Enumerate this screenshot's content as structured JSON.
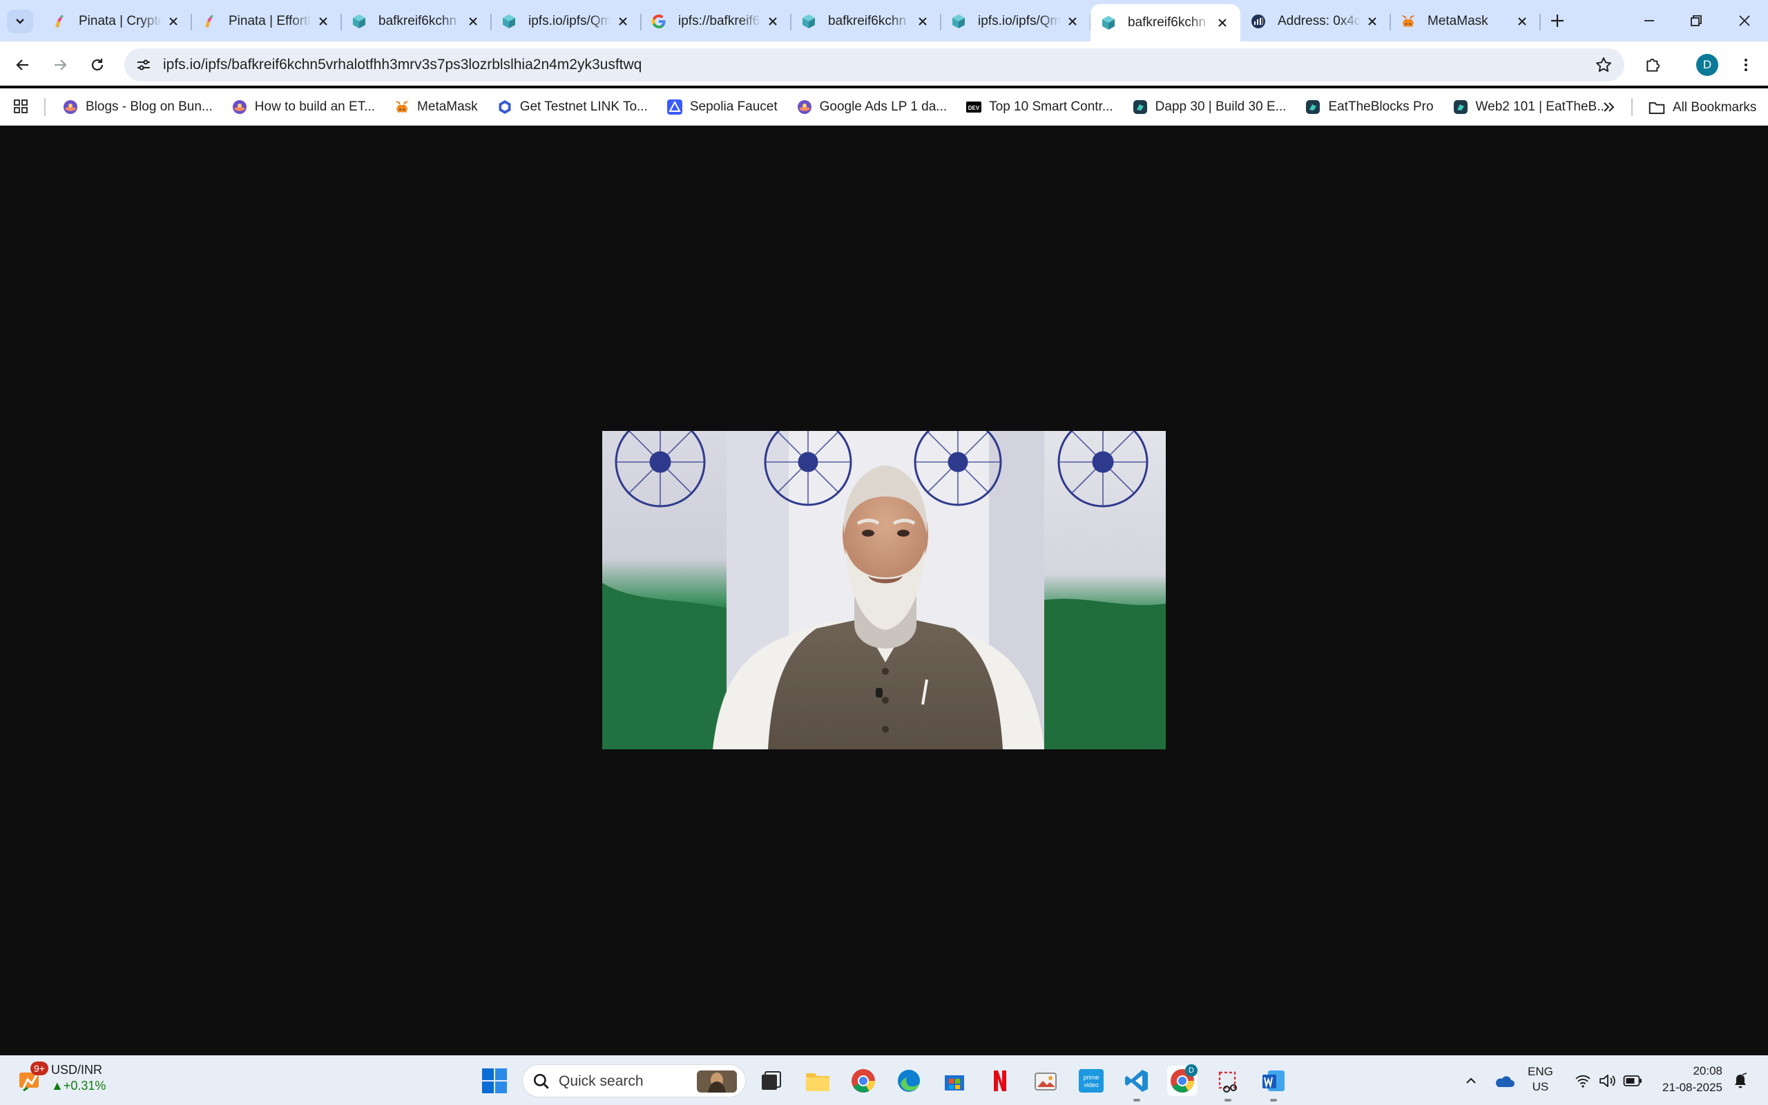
{
  "browser": {
    "tabs": [
      {
        "title": "Pinata | Crypto",
        "icon": "pinata-icon",
        "active": false
      },
      {
        "title": "Pinata | Effortless",
        "icon": "pinata-icon",
        "active": false
      },
      {
        "title": "bafkreif6kchn",
        "icon": "ipfs-cube-icon",
        "active": false
      },
      {
        "title": "ipfs.io/ipfs/Qm",
        "icon": "ipfs-cube-icon",
        "active": false
      },
      {
        "title": "ipfs://bafkreif6",
        "icon": "google-icon",
        "active": false
      },
      {
        "title": "bafkreif6kchn",
        "icon": "ipfs-cube-icon",
        "active": false
      },
      {
        "title": "ipfs.io/ipfs/Qm",
        "icon": "ipfs-cube-icon",
        "active": false
      },
      {
        "title": "bafkreif6kchn",
        "icon": "ipfs-cube-icon",
        "active": true
      },
      {
        "title": "Address: 0x4d",
        "icon": "etherscan-icon",
        "active": false
      },
      {
        "title": "MetaMask",
        "icon": "metamask-fox-icon",
        "active": false
      }
    ],
    "url": "ipfs.io/ipfs/bafkreif6kchn5vrhalotfhh3mrv3s7ps3lozrblslhia2n4m2yk3usftwq",
    "profile_initial": "D",
    "bookmarks": [
      {
        "label": "Blogs - Blog on Bun...",
        "icon": "bunny-icon"
      },
      {
        "label": "How to build an ET...",
        "icon": "bunny-icon"
      },
      {
        "label": "MetaMask",
        "icon": "metamask-fox-icon"
      },
      {
        "label": "Get Testnet LINK To...",
        "icon": "chainlink-icon"
      },
      {
        "label": "Sepolia Faucet",
        "icon": "alchemy-icon"
      },
      {
        "label": "Google Ads LP 1 da...",
        "icon": "bunny-icon"
      },
      {
        "label": "Top 10 Smart Contr...",
        "icon": "dev-icon"
      },
      {
        "label": "Dapp 30 | Build 30 E...",
        "icon": "eatblocks-icon"
      },
      {
        "label": "EatTheBlocks Pro",
        "icon": "eatblocks-icon"
      },
      {
        "label": "Web2 101 | EatTheB...",
        "icon": "eatblocks-icon"
      }
    ],
    "all_bookmarks_label": "All Bookmarks"
  },
  "taskbar": {
    "widget": {
      "badge": "9+",
      "title": "USD/INR",
      "change": "+0.31%"
    },
    "search_placeholder": "Quick search",
    "language": {
      "line1": "ENG",
      "line2": "US"
    },
    "clock": {
      "time": "20:08",
      "date": "21-08-2025"
    },
    "chrome_badge": "D"
  },
  "colors": {
    "tabstrip": "#d3e3fd",
    "page_bg": "#0e0e0e",
    "accent": "#0b57d0"
  }
}
